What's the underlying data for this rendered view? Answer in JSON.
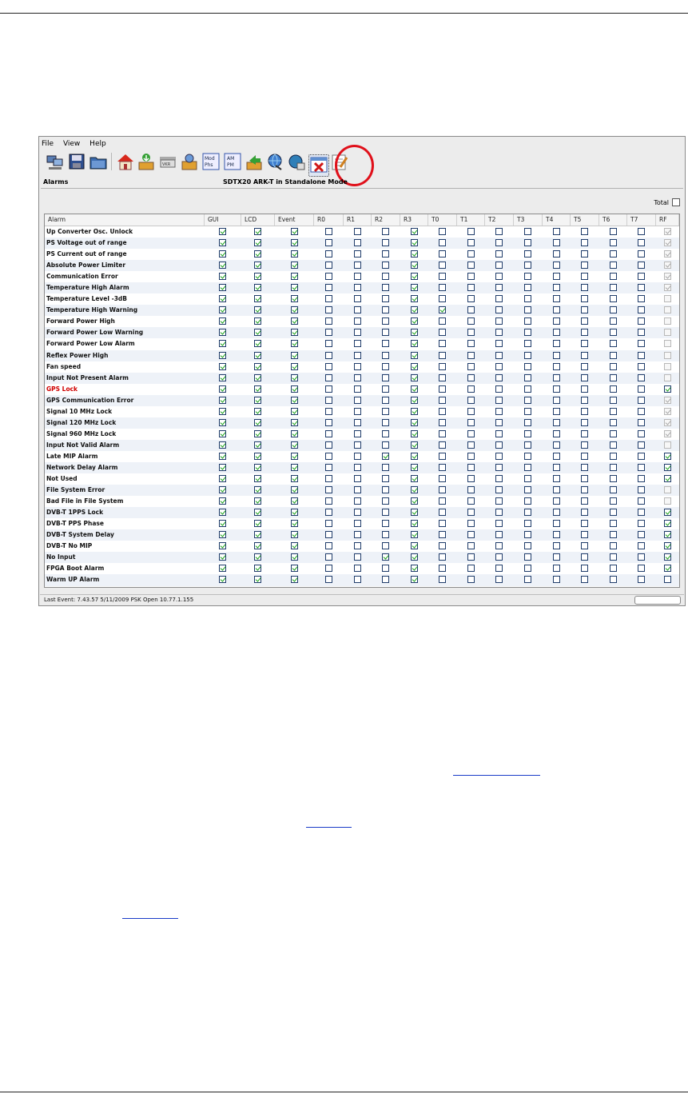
{
  "window": {
    "menu": [
      "File",
      "View",
      "Help"
    ],
    "panel_title": "Alarms",
    "center_title": "SDTX20 ARK-T in Standalone Mode",
    "total_label": "Total",
    "total_checked": false,
    "status_text": "Last Event: 7.43.57 5/11/2009 PSK Open 10.77.1.155"
  },
  "toolbar_icons": [
    "computers-icon",
    "save-icon",
    "open-folder-icon",
    "home-icon",
    "download-box-icon",
    "device-icon",
    "settings-box-icon",
    "mod-phs-icon",
    "am-pm-icon",
    "upload-box-icon",
    "network-globe-icon",
    "globe-info-icon",
    "delete-alarms-icon",
    "edit-icon"
  ],
  "table": {
    "columns": [
      "Alarm",
      "GUI",
      "LCD",
      "Event",
      "R0",
      "R1",
      "R2",
      "R3",
      "T0",
      "T1",
      "T2",
      "T3",
      "T4",
      "T5",
      "T6",
      "T7",
      "RF"
    ],
    "rows": [
      {
        "label": "Up Converter Osc. Unlock",
        "red": false,
        "r2": false,
        "t0": false,
        "rf": "dis-on"
      },
      {
        "label": "PS Voltage out of range",
        "red": false,
        "r2": false,
        "t0": false,
        "rf": "dis-on"
      },
      {
        "label": "PS Current out of range",
        "red": false,
        "r2": false,
        "t0": false,
        "rf": "dis-on"
      },
      {
        "label": "Absolute Power Limiter",
        "red": false,
        "r2": false,
        "t0": false,
        "rf": "dis-on"
      },
      {
        "label": "Communication Error",
        "red": false,
        "r2": false,
        "t0": false,
        "rf": "dis-on"
      },
      {
        "label": "Temperature High Alarm",
        "red": false,
        "r2": false,
        "t0": false,
        "rf": "dis-on"
      },
      {
        "label": "Temperature Level -3dB",
        "red": false,
        "r2": false,
        "t0": false,
        "rf": "dis-off"
      },
      {
        "label": "Temperature High Warning",
        "red": false,
        "r2": false,
        "t0": true,
        "rf": "dis-off"
      },
      {
        "label": "Forward Power High",
        "red": false,
        "r2": false,
        "t0": false,
        "rf": "dis-off"
      },
      {
        "label": "Forward Power Low Warning",
        "red": false,
        "r2": false,
        "t0": false,
        "rf": "dis-off"
      },
      {
        "label": "Forward Power Low Alarm",
        "red": false,
        "r2": false,
        "t0": false,
        "rf": "dis-off"
      },
      {
        "label": "Reflex Power High",
        "red": false,
        "r2": false,
        "t0": false,
        "rf": "dis-off"
      },
      {
        "label": "Fan speed",
        "red": false,
        "r2": false,
        "t0": false,
        "rf": "dis-off"
      },
      {
        "label": "Input Not Present Alarm",
        "red": false,
        "r2": false,
        "t0": false,
        "rf": "dis-off"
      },
      {
        "label": "GPS Lock",
        "red": true,
        "r2": false,
        "t0": false,
        "rf": "on"
      },
      {
        "label": "GPS Communication Error",
        "red": false,
        "r2": false,
        "t0": false,
        "rf": "dis-on"
      },
      {
        "label": "Signal 10 MHz Lock",
        "red": false,
        "r2": false,
        "t0": false,
        "rf": "dis-on"
      },
      {
        "label": "Signal 120 MHz Lock",
        "red": false,
        "r2": false,
        "t0": false,
        "rf": "dis-on"
      },
      {
        "label": "Signal 960 MHz Lock",
        "red": false,
        "r2": false,
        "t0": false,
        "rf": "dis-on"
      },
      {
        "label": "Input Not Valid Alarm",
        "red": false,
        "r2": false,
        "t0": false,
        "rf": "dis-off"
      },
      {
        "label": "Late MIP Alarm",
        "red": false,
        "r2": true,
        "t0": false,
        "rf": "on"
      },
      {
        "label": "Network Delay Alarm",
        "red": false,
        "r2": false,
        "t0": false,
        "rf": "on"
      },
      {
        "label": "Not Used",
        "red": false,
        "r2": false,
        "t0": false,
        "rf": "on"
      },
      {
        "label": "File System Error",
        "red": false,
        "r2": false,
        "t0": false,
        "rf": "dis-off"
      },
      {
        "label": "Bad File in File System",
        "red": false,
        "r2": false,
        "t0": false,
        "rf": "dis-off"
      },
      {
        "label": "DVB-T 1PPS Lock",
        "red": false,
        "r2": false,
        "t0": false,
        "rf": "on"
      },
      {
        "label": "DVB-T PPS Phase",
        "red": false,
        "r2": false,
        "t0": false,
        "rf": "on"
      },
      {
        "label": "DVB-T System Delay",
        "red": false,
        "r2": false,
        "t0": false,
        "rf": "on"
      },
      {
        "label": "DVB-T No MIP",
        "red": false,
        "r2": false,
        "t0": false,
        "rf": "on"
      },
      {
        "label": "No Input",
        "red": false,
        "r2": true,
        "t0": false,
        "rf": "on"
      },
      {
        "label": "FPGA Boot Alarm",
        "red": false,
        "r2": false,
        "t0": false,
        "rf": "on"
      },
      {
        "label": "Warm UP Alarm",
        "red": false,
        "r2": false,
        "t0": false,
        "rf": "off"
      }
    ]
  },
  "colors": {
    "check": "#1aa01a",
    "highlight_circle": "#e0101a",
    "link": "#1a3cc8"
  }
}
